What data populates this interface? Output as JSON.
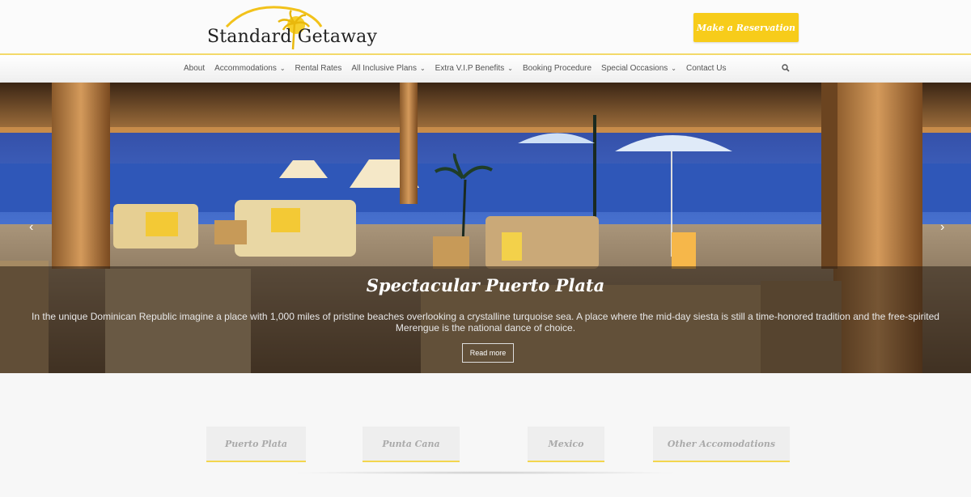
{
  "header": {
    "logo_text": "Standard Getaway",
    "reserve_label": "Make a Reservation"
  },
  "nav": {
    "items": [
      {
        "label": "About",
        "dropdown": false
      },
      {
        "label": "Accommodations",
        "dropdown": true
      },
      {
        "label": "Rental Rates",
        "dropdown": false
      },
      {
        "label": "All Inclusive Plans",
        "dropdown": true
      },
      {
        "label": "Extra V.I.P Benefits",
        "dropdown": true
      },
      {
        "label": "Booking Procedure",
        "dropdown": false
      },
      {
        "label": "Special Occasions",
        "dropdown": true
      },
      {
        "label": "Contact Us",
        "dropdown": false
      }
    ]
  },
  "slider": {
    "title": "Spectacular Puerto Plata",
    "text": "In the unique Dominican Republic imagine a place with 1,000 miles of pristine beaches overlooking a crystalline turquoise sea. A place where the mid-day siesta is still a time-honored tradition and the free-spirited Merengue is the national dance of choice.",
    "button": "Read more",
    "prev_glyph": "‹",
    "next_glyph": "›"
  },
  "tabs": [
    {
      "label": "Puerto Plata"
    },
    {
      "label": "Punta Cana"
    },
    {
      "label": "Mexico"
    },
    {
      "label": "Other Accomodations"
    }
  ],
  "colors": {
    "accent": "#f7cc1a",
    "nav_border": "#f3d96a",
    "tab_border": "#f3d64e"
  }
}
